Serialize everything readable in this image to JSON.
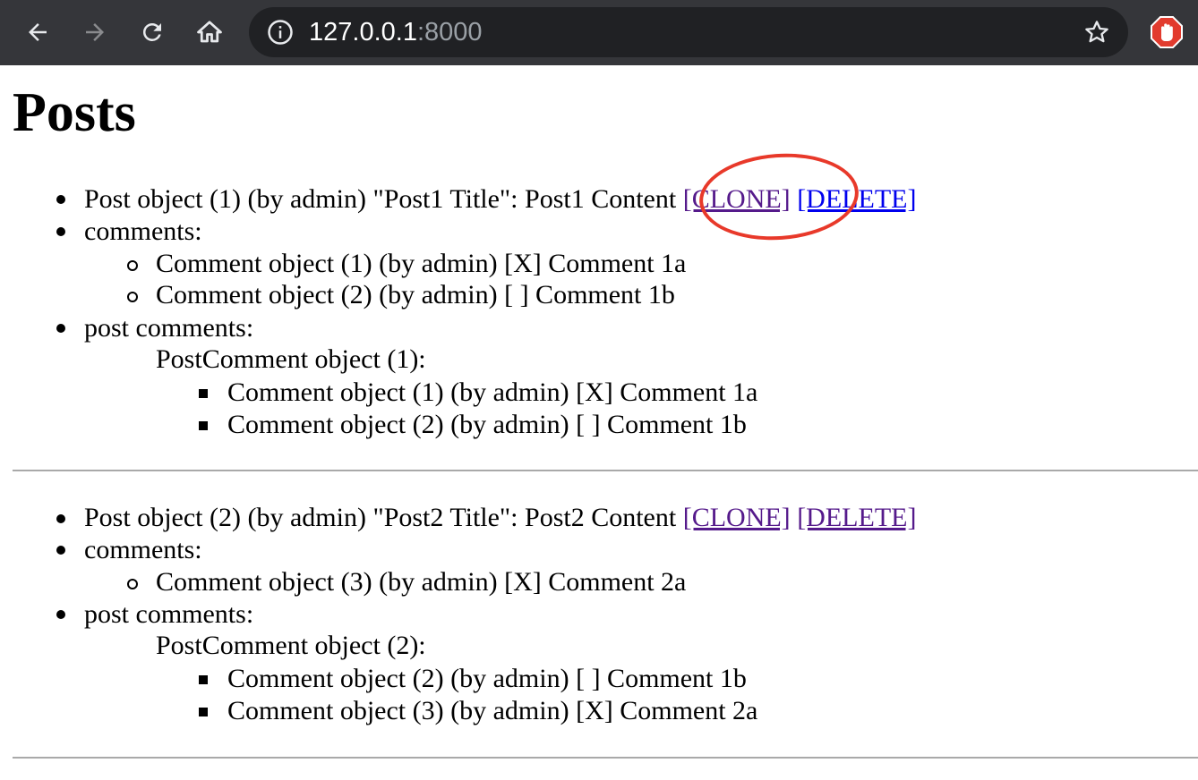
{
  "browser": {
    "url_host": "127.0.0.1",
    "url_port": ":8000",
    "icons": [
      "back-arrow-icon",
      "forward-arrow-icon",
      "reload-icon",
      "home-icon",
      "info-icon",
      "star-icon",
      "adblock-extension-icon"
    ]
  },
  "page": {
    "title": "Posts",
    "posts": [
      {
        "summary": "Post object (1) (by admin) \"Post1 Title\": Post1 Content",
        "clone_label": "[CLONE]",
        "delete_label": "[DELETE]",
        "comments_label": "comments:",
        "comments": [
          "Comment object (1) (by admin) [X] Comment 1a",
          "Comment object (2) (by admin) [ ] Comment 1b"
        ],
        "post_comments_label": "post comments:",
        "post_comment_heading": "PostComment object (1):",
        "post_comment_items": [
          "Comment object (1) (by admin) [X] Comment 1a",
          "Comment object (2) (by admin) [ ] Comment 1b"
        ]
      },
      {
        "summary": "Post object (2) (by admin) \"Post2 Title\": Post2 Content",
        "clone_label": "[CLONE]",
        "delete_label": "[DELETE]",
        "comments_label": "comments:",
        "comments": [
          "Comment object (3) (by admin) [X] Comment 2a"
        ],
        "post_comments_label": "post comments:",
        "post_comment_heading": "PostComment object (2):",
        "post_comment_items": [
          "Comment object (2) (by admin) [ ] Comment 1b",
          "Comment object (3) (by admin) [X] Comment 2a"
        ]
      }
    ]
  },
  "colors": {
    "toolbar": "#35363a",
    "omnibox": "#202124",
    "link_visited": "#551a8b",
    "link_unvisited": "#0000ee",
    "annotation_circle": "#e8392a"
  }
}
